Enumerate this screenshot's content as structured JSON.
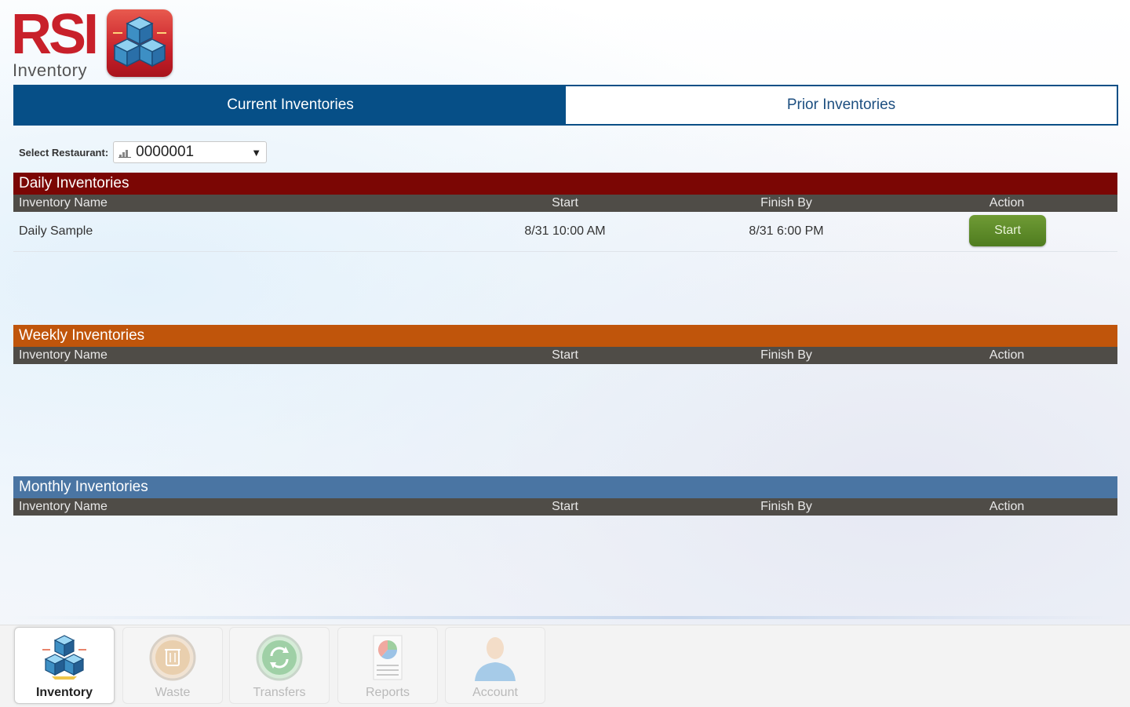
{
  "logo": {
    "title": "RSI",
    "subtitle": "Inventory"
  },
  "tabs": [
    {
      "label": "Current Inventories",
      "active": true
    },
    {
      "label": "Prior Inventories",
      "active": false
    }
  ],
  "restaurant": {
    "label": "Select Restaurant:",
    "value": "0000001"
  },
  "columns": {
    "name": "Inventory Name",
    "start": "Start",
    "finish": "Finish By",
    "action": "Action"
  },
  "sections": {
    "daily": {
      "title": "Daily Inventories",
      "color": "#7b0604",
      "rows": [
        {
          "name": "Daily Sample",
          "start": "8/31 10:00 AM",
          "finish": "8/31 6:00 PM",
          "action": "Start"
        }
      ]
    },
    "weekly": {
      "title": "Weekly Inventories",
      "color": "#c0550b",
      "rows": []
    },
    "monthly": {
      "title": "Monthly Inventories",
      "color": "#4a75a3",
      "rows": []
    }
  },
  "nav": [
    {
      "label": "Inventory",
      "icon": "inventory-cubes-icon",
      "active": true
    },
    {
      "label": "Waste",
      "icon": "trash-icon",
      "active": false
    },
    {
      "label": "Transfers",
      "icon": "transfer-arrows-icon",
      "active": false
    },
    {
      "label": "Reports",
      "icon": "report-chart-icon",
      "active": false
    },
    {
      "label": "Account",
      "icon": "user-icon",
      "active": false
    }
  ]
}
